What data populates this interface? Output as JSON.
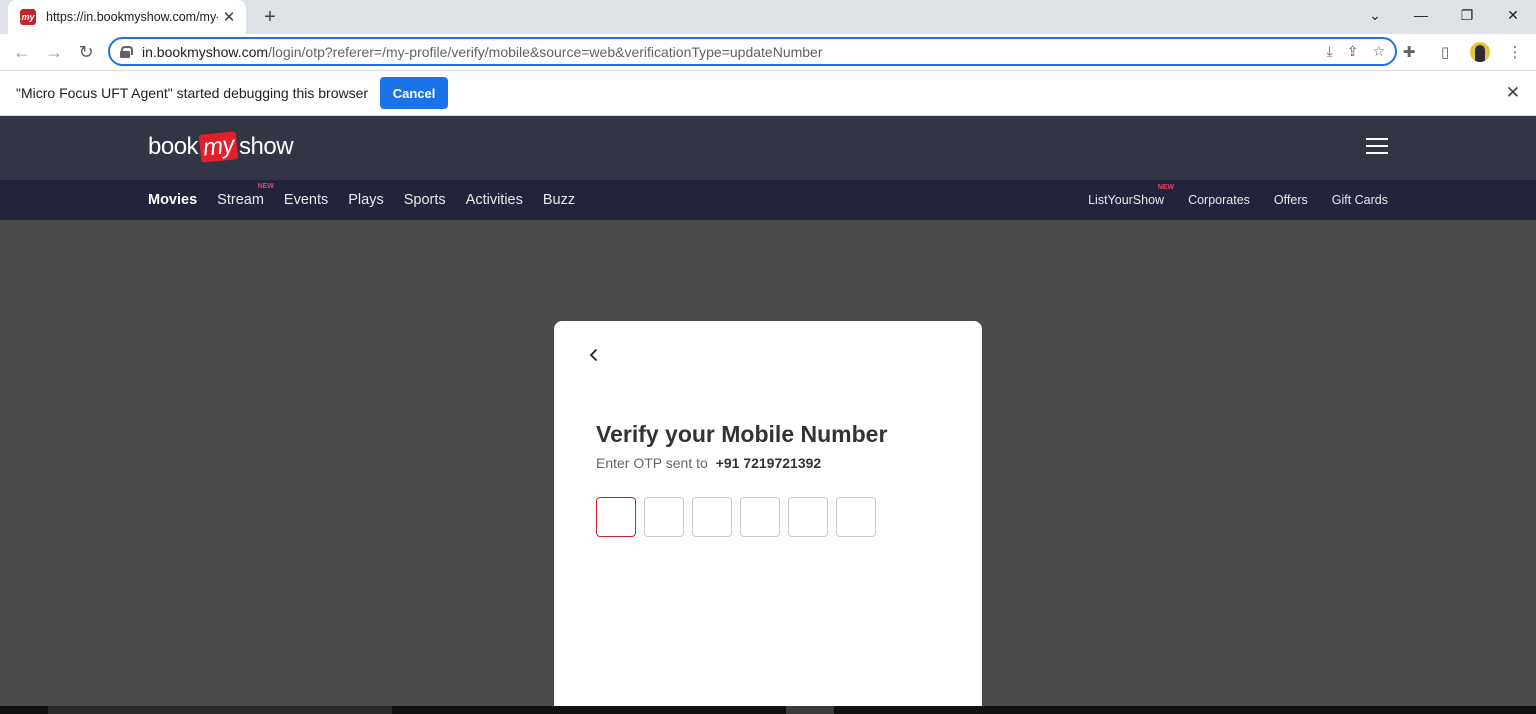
{
  "browser": {
    "tab_title": "https://in.bookmyshow.com/my-profile/verify/mobile",
    "favicon_text": "my",
    "url_host": "in.bookmyshow.com",
    "url_path": "/login/otp?referer=/my-profile/verify/mobile&source=web&verificationType=updateNumber"
  },
  "infobar": {
    "message": "\"Micro Focus UFT Agent\" started debugging this browser",
    "cancel_label": "Cancel"
  },
  "site": {
    "logo_book": "book",
    "logo_my": "my",
    "logo_show": "show",
    "nav_left": [
      {
        "label": "Movies",
        "badge": ""
      },
      {
        "label": "Stream",
        "badge": "NEW"
      },
      {
        "label": "Events",
        "badge": ""
      },
      {
        "label": "Plays",
        "badge": ""
      },
      {
        "label": "Sports",
        "badge": ""
      },
      {
        "label": "Activities",
        "badge": ""
      },
      {
        "label": "Buzz",
        "badge": ""
      }
    ],
    "nav_right": [
      {
        "label": "ListYourShow",
        "badge": "NEW"
      },
      {
        "label": "Corporates",
        "badge": ""
      },
      {
        "label": "Offers",
        "badge": ""
      },
      {
        "label": "Gift Cards",
        "badge": ""
      }
    ]
  },
  "modal": {
    "title": "Verify your Mobile Number",
    "subtitle": "Enter OTP sent to",
    "phone": "+91 7219721392",
    "otp_values": [
      "",
      "",
      "",
      "",
      "",
      ""
    ]
  },
  "colors": {
    "brand": "#c4242b",
    "header_bg": "#333545",
    "nav_bg": "#222539",
    "overlay": "#4b4b4b",
    "chrome_accent": "#1a73e8"
  }
}
